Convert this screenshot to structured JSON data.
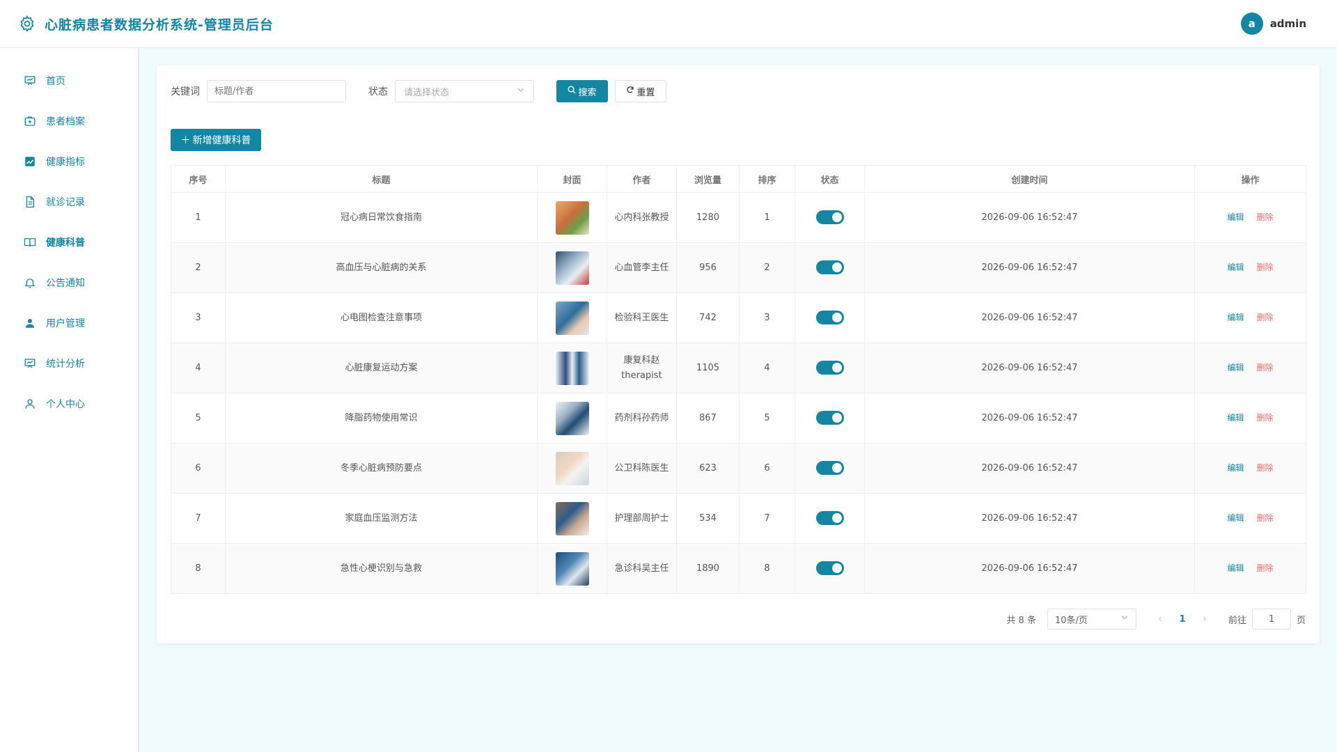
{
  "header": {
    "title": "心脏病患者数据分析系统-管理员后台",
    "avatar_letter": "a",
    "username": "admin"
  },
  "sidebar": {
    "items": [
      {
        "label": "首页",
        "icon": "presentation-icon"
      },
      {
        "label": "患者档案",
        "icon": "medical-kit-icon"
      },
      {
        "label": "健康指标",
        "icon": "trend-chart-icon"
      },
      {
        "label": "就诊记录",
        "icon": "document-icon"
      },
      {
        "label": "健康科普",
        "icon": "book-icon",
        "active": true
      },
      {
        "label": "公告通知",
        "icon": "bell-icon"
      },
      {
        "label": "用户管理",
        "icon": "user-filled-icon"
      },
      {
        "label": "统计分析",
        "icon": "presentation-icon"
      },
      {
        "label": "个人中心",
        "icon": "user-icon"
      }
    ]
  },
  "filters": {
    "keyword_label": "关键词",
    "keyword_placeholder": "标题/作者",
    "keyword_value": "",
    "status_label": "状态",
    "status_placeholder": "请选择状态",
    "search_label": "搜索",
    "reset_label": "重置"
  },
  "add_button_label": "新增健康科普",
  "table": {
    "columns": [
      "序号",
      "标题",
      "封面",
      "作者",
      "浏览量",
      "排序",
      "状态",
      "创建时间",
      "操作"
    ],
    "rows": [
      {
        "index": "1",
        "title": "冠心病日常饮食指南",
        "author": "心内科张教授",
        "views": "1280",
        "order": "1",
        "status": true,
        "created": "2026-09-06 16:52:47"
      },
      {
        "index": "2",
        "title": "高血压与心脏病的关系",
        "author": "心血管李主任",
        "views": "956",
        "order": "2",
        "status": true,
        "created": "2026-09-06 16:52:47"
      },
      {
        "index": "3",
        "title": "心电图检查注意事项",
        "author": "检验科王医生",
        "views": "742",
        "order": "3",
        "status": true,
        "created": "2026-09-06 16:52:47"
      },
      {
        "index": "4",
        "title": "心脏康复运动方案",
        "author": "康复科赵therapist",
        "views": "1105",
        "order": "4",
        "status": true,
        "created": "2026-09-06 16:52:47"
      },
      {
        "index": "5",
        "title": "降脂药物使用常识",
        "author": "药剂科孙药师",
        "views": "867",
        "order": "5",
        "status": true,
        "created": "2026-09-06 16:52:47"
      },
      {
        "index": "6",
        "title": "冬季心脏病预防要点",
        "author": "公卫科陈医生",
        "views": "623",
        "order": "6",
        "status": true,
        "created": "2026-09-06 16:52:47"
      },
      {
        "index": "7",
        "title": "家庭血压监测方法",
        "author": "护理部周护士",
        "views": "534",
        "order": "7",
        "status": true,
        "created": "2026-09-06 16:52:47"
      },
      {
        "index": "8",
        "title": "急性心梗识别与急救",
        "author": "急诊科吴主任",
        "views": "1890",
        "order": "8",
        "status": true,
        "created": "2026-09-06 16:52:47"
      }
    ],
    "edit_label": "编辑",
    "delete_label": "删除"
  },
  "pagination": {
    "total_text": "共 8 条",
    "page_size": "10条/页",
    "current_page": "1",
    "goto_prefix": "前往",
    "goto_value": "1",
    "goto_suffix": "页"
  },
  "colors": {
    "accent": "#1286a3",
    "danger": "#f56c6c",
    "background": "#f0fbfd"
  }
}
